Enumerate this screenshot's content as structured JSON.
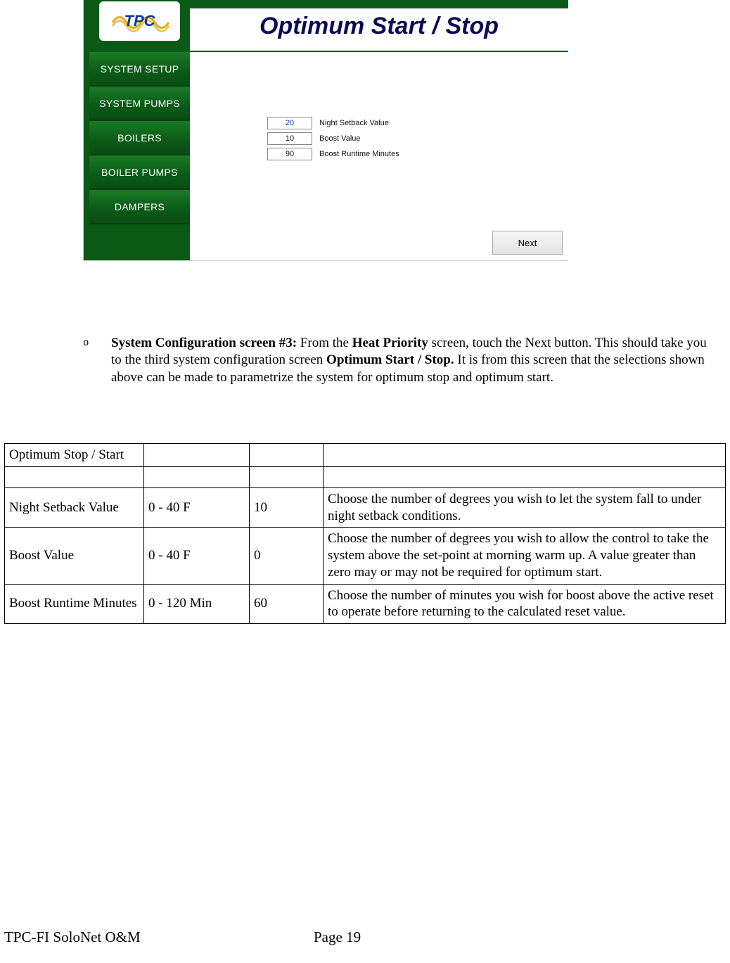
{
  "ui": {
    "logo_text": "TPC",
    "title": "Optimum Start / Stop",
    "sidebar": [
      "SYSTEM SETUP",
      "SYSTEM PUMPS",
      "BOILERS",
      "BOILER PUMPS",
      "DAMPERS"
    ],
    "fields": [
      {
        "value": "20",
        "label": "Night Setback Value",
        "selected": true
      },
      {
        "value": "10",
        "label": "Boost Value",
        "selected": false
      },
      {
        "value": "90",
        "label": "Boost Runtime Minutes",
        "selected": false
      }
    ],
    "next_label": "Next"
  },
  "bullet": {
    "marker": "o",
    "bold1": "System Configuration screen #3:",
    "text1": "  From the ",
    "bold2": "Heat Priority",
    "text2": " screen, touch the Next button. This should take you to the third system configuration screen ",
    "bold3": "Optimum Start / Stop.",
    "text3": "  It is from this screen that the selections shown above can be made to parametrize the system for optimum stop and optimum start."
  },
  "table": {
    "header": "Optimum Stop / Start",
    "rows": [
      {
        "name": "Night Setback Value",
        "range": "0 - 40 F",
        "default": "10",
        "desc": "Choose the number of degrees you wish to let the system fall to under night setback conditions."
      },
      {
        "name": "Boost Value",
        "range": "0 - 40 F",
        "default": "0",
        "desc": "Choose the number of degrees you wish to allow the control to take the system above the set-point at morning warm up.  A value greater than zero may or may not be required for optimum start."
      },
      {
        "name": "Boost Runtime Minutes",
        "range": "0 - 120 Min",
        "default": "60",
        "desc": "Choose the number of minutes you wish for boost above the active reset to operate before returning to the calculated reset value."
      }
    ]
  },
  "footer": {
    "left": "TPC-FI SoloNet O&M",
    "right": "Page 19"
  }
}
